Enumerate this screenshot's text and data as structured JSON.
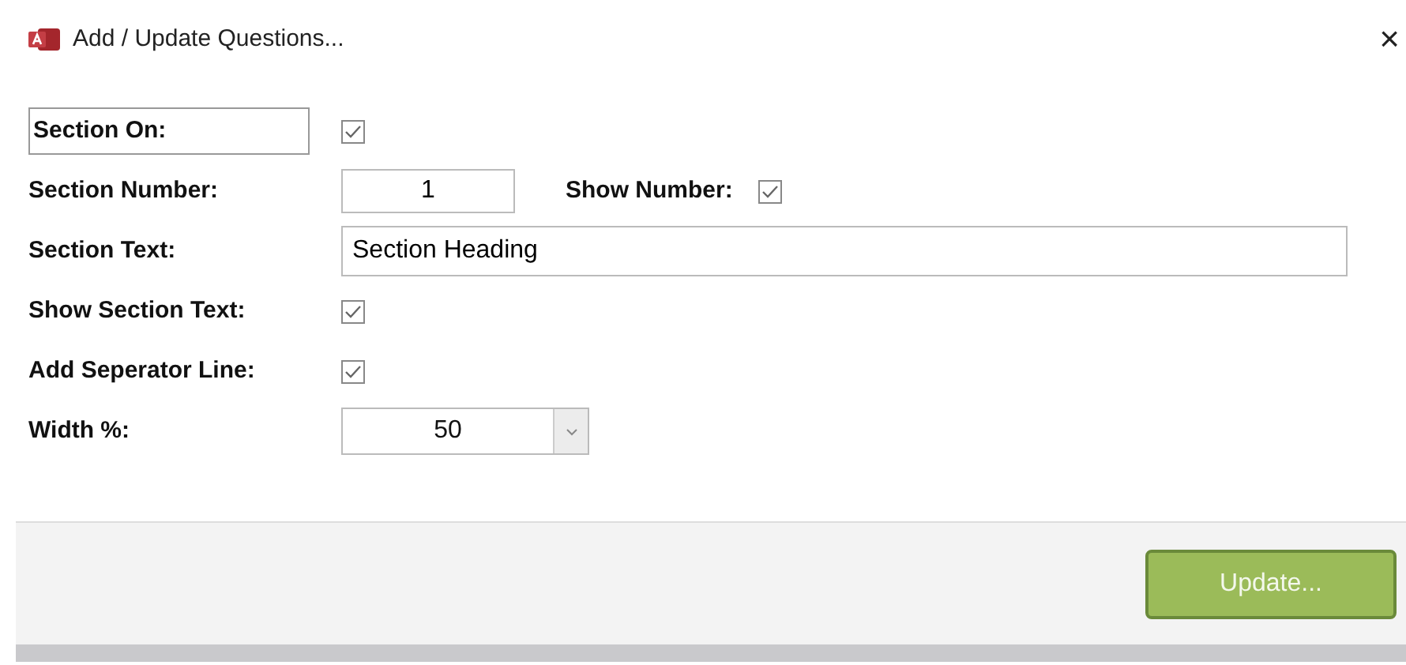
{
  "window": {
    "title": "Add / Update Questions...",
    "close": "×"
  },
  "fields": [
    {
      "kind": "checkbox",
      "label": "Section On:",
      "label_boxed": true,
      "checked": true
    },
    {
      "kind": "number",
      "label": "Section Number:",
      "value": "1",
      "extra": {
        "label": "Show Number:",
        "checked": true
      }
    },
    {
      "kind": "text",
      "label": "Section Text:",
      "value": "Section Heading"
    },
    {
      "kind": "checkbox",
      "label": "Show Section Text:",
      "checked": true
    },
    {
      "kind": "checkbox",
      "label": "Add Seperator Line:",
      "checked": true
    },
    {
      "kind": "combo",
      "label": "Width %:",
      "value": "50"
    }
  ],
  "buttons": [
    {
      "label": "Update..."
    }
  ]
}
